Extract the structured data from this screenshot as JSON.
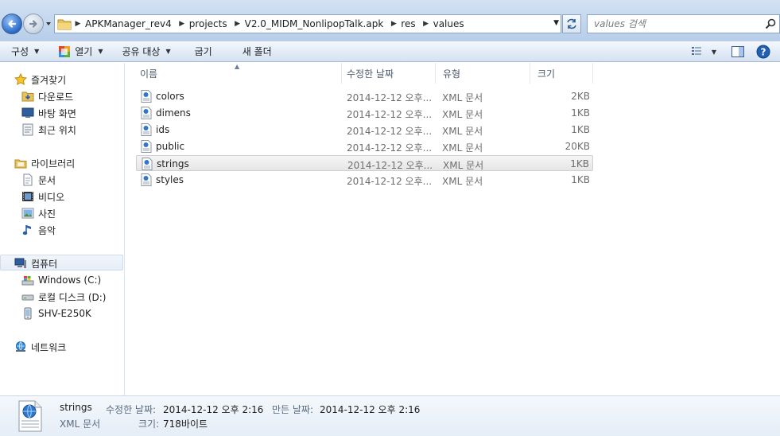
{
  "address": {
    "crumbs": [
      "APKManager_rev4",
      "projects",
      "V2.0_MIDM_NonlipopTalk.apk",
      "res",
      "values"
    ],
    "search_placeholder": "values 검색"
  },
  "toolbar": {
    "organize": "구성",
    "open": "열기",
    "share": "공유 대상",
    "burn": "굽기",
    "new_folder": "새 폴더"
  },
  "nav": {
    "favorites": "즐겨찾기",
    "downloads": "다운로드",
    "desktop": "바탕 화면",
    "recent": "최근 위치",
    "libraries": "라이브러리",
    "documents": "문서",
    "videos": "비디오",
    "pictures": "사진",
    "music": "음악",
    "computer": "컴퓨터",
    "drive_c": "Windows (C:)",
    "drive_d": "로컬 디스크 (D:)",
    "device": "SHV-E250K",
    "network": "네트워크"
  },
  "columns": {
    "name": "이름",
    "date": "수정한 날짜",
    "type": "유형",
    "size": "크기"
  },
  "files": [
    {
      "name": "colors",
      "date": "2014-12-12 오후...",
      "type": "XML 문서",
      "size": "2KB"
    },
    {
      "name": "dimens",
      "date": "2014-12-12 오후...",
      "type": "XML 문서",
      "size": "1KB"
    },
    {
      "name": "ids",
      "date": "2014-12-12 오후...",
      "type": "XML 문서",
      "size": "1KB"
    },
    {
      "name": "public",
      "date": "2014-12-12 오후...",
      "type": "XML 문서",
      "size": "20KB"
    },
    {
      "name": "strings",
      "date": "2014-12-12 오후...",
      "type": "XML 문서",
      "size": "1KB"
    },
    {
      "name": "styles",
      "date": "2014-12-12 오후...",
      "type": "XML 문서",
      "size": "1KB"
    }
  ],
  "selected_index": 4,
  "details": {
    "name": "strings",
    "type": "XML 문서",
    "modified_label": "수정한 날짜:",
    "modified_value": "2014-12-12 오후 2:16",
    "created_label": "만든 날짜:",
    "created_value": "2014-12-12 오후 2:16",
    "size_label": "크기:",
    "size_value": "718바이트"
  },
  "colors": {
    "accent_blue": "#2968c8",
    "selection_gray": "#e6e6e6"
  }
}
